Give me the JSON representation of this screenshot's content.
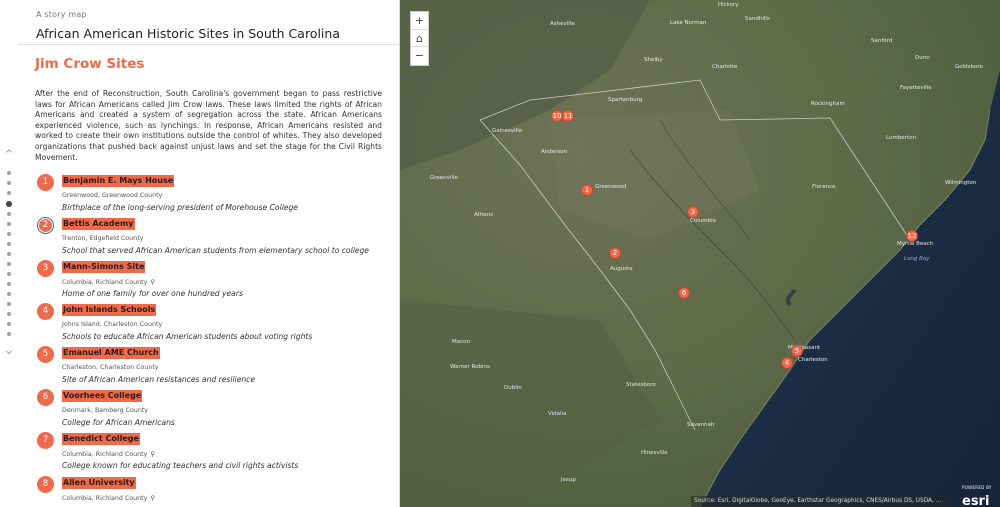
{
  "story": {
    "eyebrow": "A story map",
    "title": "African American Historic Sites in South Carolina"
  },
  "section": {
    "title": "Jim Crow Sites",
    "intro": "After the end of Reconstruction, South Carolina's government began to pass restrictive laws for African Americans called Jim Crow laws. These laws limited the rights of African Americans and created a system of segregation across the state. African Americans experienced violence, such as lynchings. In response, African Americans resisted and worked to create their own institutions outside the control of whites. They also developed organizations that pushed back against unjust laws and set the stage for the Civil Rights Movement."
  },
  "nav": {
    "up_icon": "chevron-up-icon",
    "down_icon": "chevron-down-icon"
  },
  "sites": [
    {
      "num": "1",
      "name": "Benjamin E. Mays House",
      "location": "Greenwood, Greenwood County",
      "description": "Birthplace of the long-serving president of Morehouse College",
      "zoom_icon": false
    },
    {
      "num": "2",
      "name": "Bettis Academy",
      "location": "Trenton, Edgefield County",
      "description": "School that served African American students from elementary school to college",
      "zoom_icon": false
    },
    {
      "num": "3",
      "name": "Mann-Simons Site",
      "location": "Columbia, Richland County",
      "description": "Home of one family for over one hundred years",
      "zoom_icon": true
    },
    {
      "num": "4",
      "name": "John Islands Schools",
      "location": "Johns Island, Charleston County",
      "description": "Schools to educate African American students about voting rights",
      "zoom_icon": false
    },
    {
      "num": "5",
      "name": "Emanuel AME Church",
      "location": "Charleston, Charleston County",
      "description": "Site of African American resistances and resilience",
      "zoom_icon": false
    },
    {
      "num": "6",
      "name": "Voorhees College",
      "location": "Denmark, Bamberg County",
      "description": "College for African Americans",
      "zoom_icon": false
    },
    {
      "num": "7",
      "name": "Benedict College",
      "location": "Columbia, Richland County",
      "description": "College known for educating teachers and civil rights activists",
      "zoom_icon": true
    },
    {
      "num": "8",
      "name": "Allen University",
      "location": "Columbia, Richland County",
      "description": "",
      "zoom_icon": true
    }
  ],
  "map": {
    "zoom_in": "+",
    "home_icon": "home-icon",
    "zoom_out": "−",
    "pins": [
      "1",
      "2",
      "3",
      "4",
      "5",
      "6",
      "10",
      "11",
      "12"
    ],
    "towns": [
      "Asheville",
      "Charlotte",
      "Spartanburg",
      "Anderson",
      "Greenwood",
      "Columbia",
      "Augusta",
      "Athens",
      "Florence",
      "Fayetteville",
      "Wilmington",
      "Lumberton",
      "Rockingham",
      "Myrtle Beach",
      "Charleston",
      "Mt Pleasant",
      "Savannah",
      "Macon",
      "Warner Robins",
      "Statesboro",
      "Jesup",
      "Hinesville",
      "Vidalia",
      "Dublin",
      "Greenville",
      "Sandhills",
      "Hickory",
      "Shelby",
      "Sanford",
      "Goldsboro",
      "Dunn",
      "Lake Norman",
      "Gainesville"
    ],
    "water_labels": [
      "Long Bay"
    ],
    "attribution": "Source: Esri, DigitalGlobe, GeoEye, Earthstar Geographics, CNES/Airbus DS, USDA, ...",
    "logo_powered": "POWERED BY",
    "logo_word": "esri",
    "brand_color": "#ef6a4b"
  }
}
